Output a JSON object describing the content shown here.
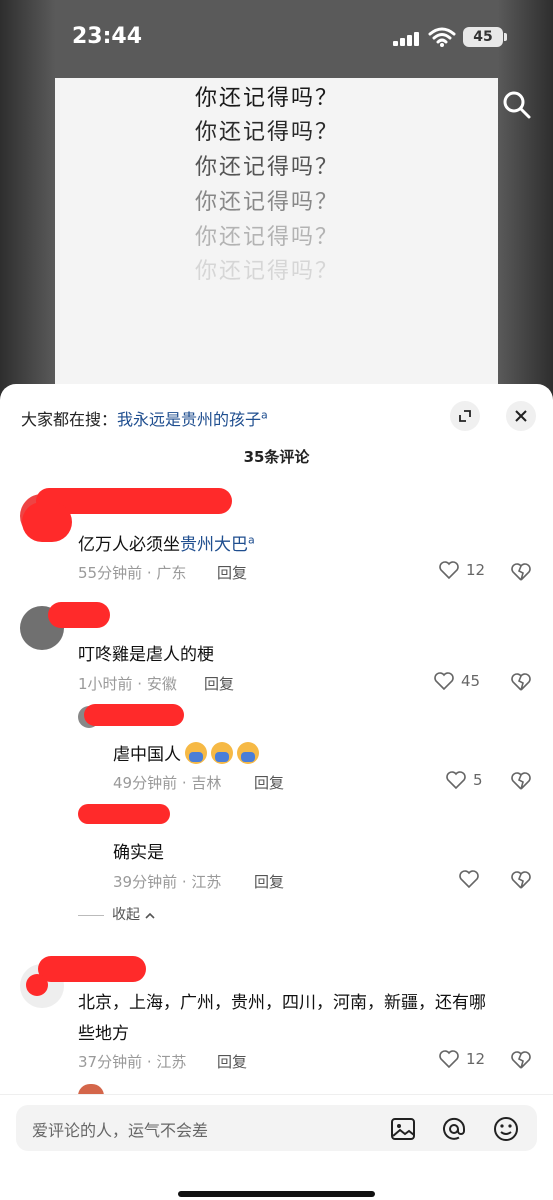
{
  "status_bar": {
    "time": "23:44",
    "battery": "45"
  },
  "video": {
    "poem_lines": [
      "你还记得吗？",
      "你还记得吗？",
      "你还记得吗？",
      "你还记得吗？",
      "你还记得吗？",
      "你还记得吗？"
    ]
  },
  "sheet": {
    "search_prefix": "大家都在搜：",
    "search_link": "我永远是贵州的孩子",
    "comment_count": "35条评论",
    "collapse_label": "收起",
    "reply_label": "回复"
  },
  "comments": [
    {
      "text_plain": "亿万人必须坐",
      "text_tag": "贵州大巴",
      "meta": "55分钟前 · 广东",
      "likes": "12"
    },
    {
      "text_plain": "叮咚雞是虐人的梗",
      "meta": "1小时前 · 安徽",
      "likes": "45"
    },
    {
      "text_plain": "虐中国人",
      "meta": "49分钟前 · 吉林",
      "likes": "5"
    },
    {
      "text_plain": "确实是",
      "meta": "39分钟前 · 江苏",
      "likes": ""
    },
    {
      "text_line1": "北京，上海，广州，贵州，四川，河南，新疆，还有哪",
      "text_line2": "些地方",
      "meta": "37分钟前 · 江苏",
      "likes": "12"
    }
  ],
  "input": {
    "placeholder": "爱评论的人，运气不会差"
  }
}
